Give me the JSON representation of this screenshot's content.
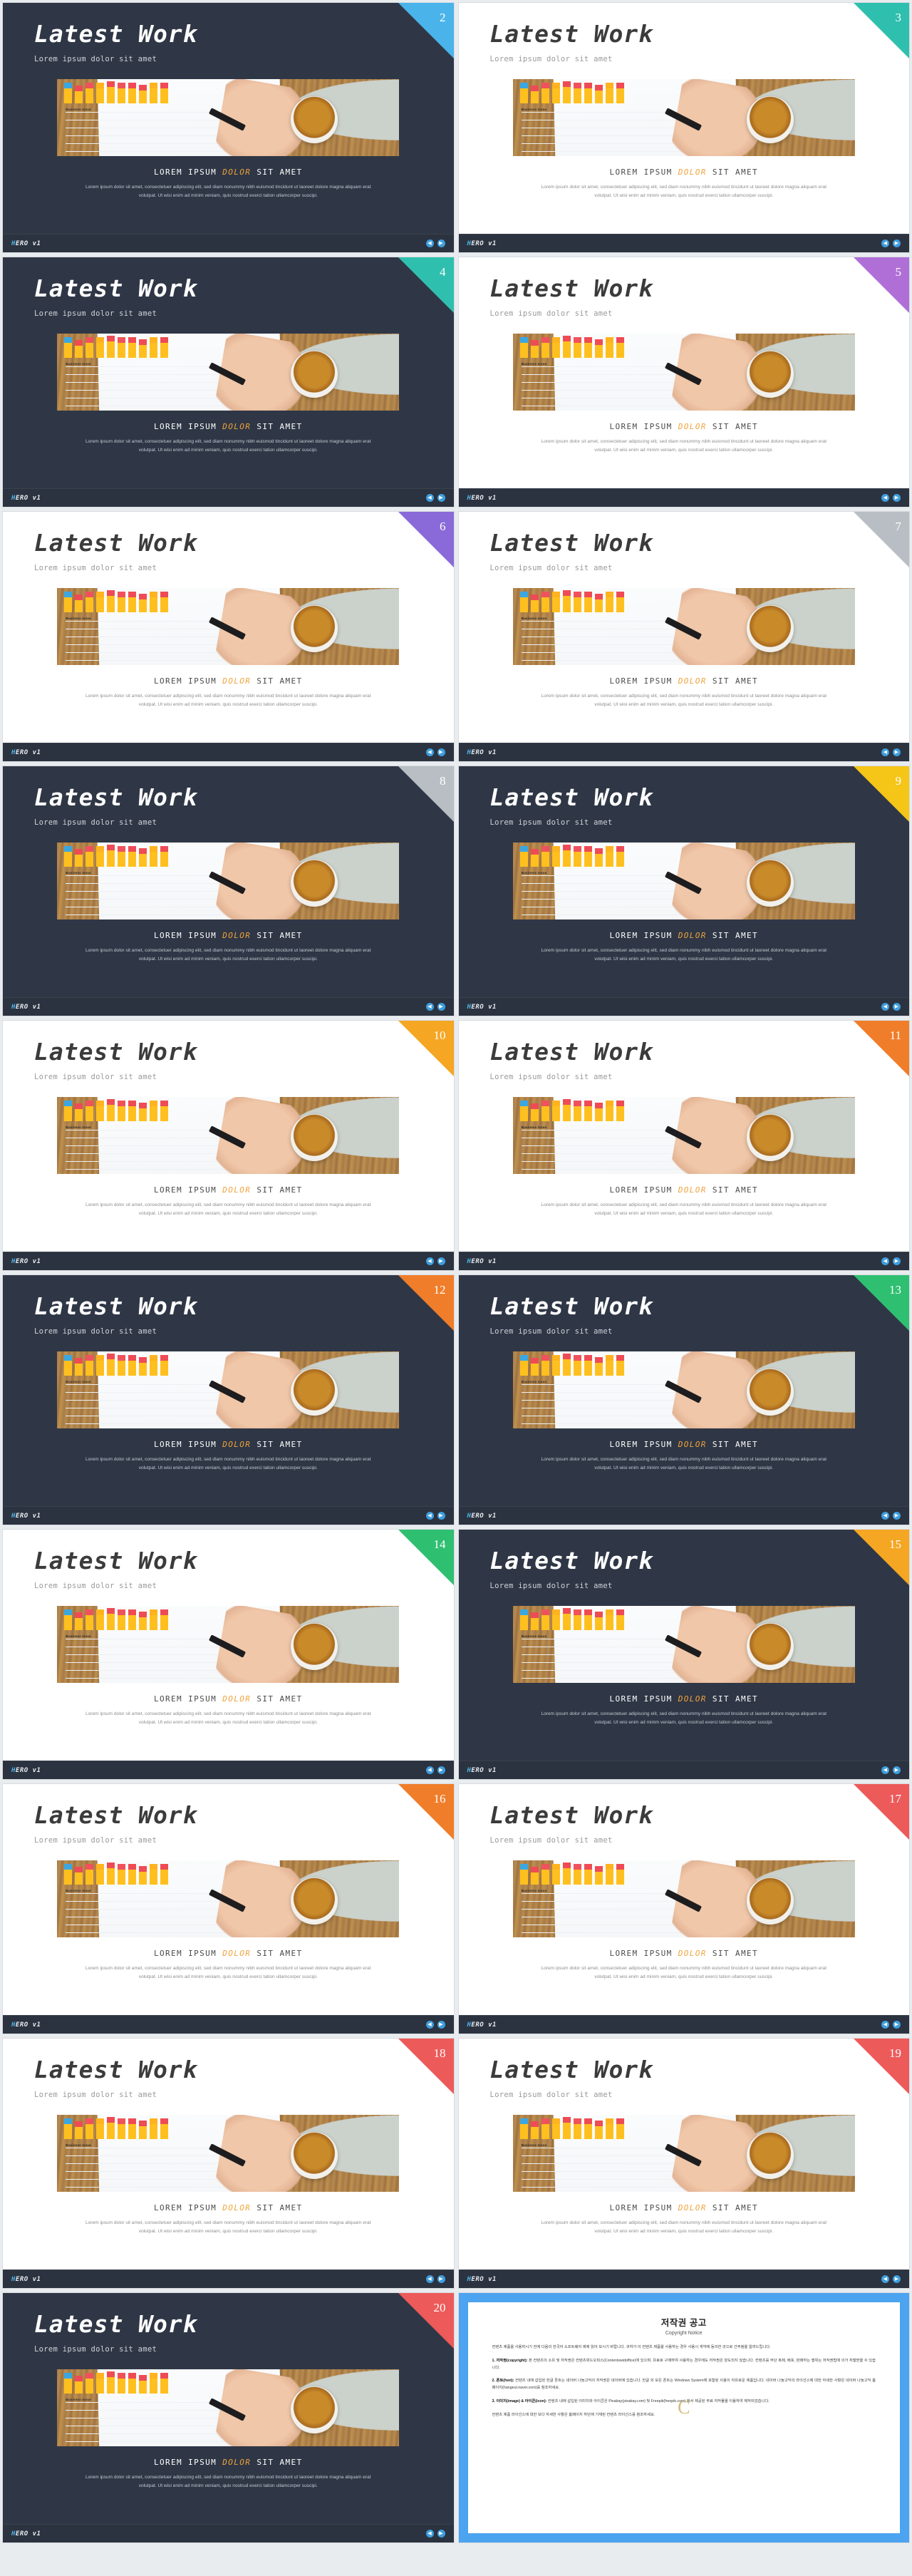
{
  "slide_common": {
    "title": "Latest Work",
    "subtitle": "Lorem ipsum dolor sit amet",
    "caption_pre": "LOREM IPSUM ",
    "caption_accent": "DOLOR",
    "caption_post": " SIT AMET",
    "body": "Lorem ipsum dolor sit amet, consectetuer adipiscing elit, sed diam nonummy nibh euismod tincidunt ut laoreet dolore magna aliquam erat volutpat. Ut wisi enim ad minim veniam, quis nostrud exerci tation ullamcorper suscipi.",
    "brand_first": "H",
    "brand_rest": "ERO v1",
    "nav_prev": "◀",
    "nav_next": "▶",
    "photo_label": "Business Issue"
  },
  "slides": [
    {
      "n": "2",
      "theme": "dark",
      "ribbon": "#4ab4ea"
    },
    {
      "n": "3",
      "theme": "light",
      "ribbon": "#2fbfae"
    },
    {
      "n": "4",
      "theme": "dark",
      "ribbon": "#2fbfae"
    },
    {
      "n": "5",
      "theme": "light",
      "ribbon": "#b06fd6"
    },
    {
      "n": "6",
      "theme": "light",
      "ribbon": "#8a6ad8"
    },
    {
      "n": "7",
      "theme": "light",
      "ribbon": "#b9bec4"
    },
    {
      "n": "8",
      "theme": "dark",
      "ribbon": "#b9bec4"
    },
    {
      "n": "9",
      "theme": "dark",
      "ribbon": "#f5c518"
    },
    {
      "n": "10",
      "theme": "light",
      "ribbon": "#f5a623"
    },
    {
      "n": "11",
      "theme": "light",
      "ribbon": "#f07d2a"
    },
    {
      "n": "12",
      "theme": "dark",
      "ribbon": "#f07d2a"
    },
    {
      "n": "13",
      "theme": "dark",
      "ribbon": "#2fbf71"
    },
    {
      "n": "14",
      "theme": "light",
      "ribbon": "#2fbf71"
    },
    {
      "n": "15",
      "theme": "dark",
      "ribbon": "#f5a623"
    },
    {
      "n": "16",
      "theme": "light",
      "ribbon": "#f07d2a"
    },
    {
      "n": "17",
      "theme": "light",
      "ribbon": "#ed5a5a"
    },
    {
      "n": "18",
      "theme": "light",
      "ribbon": "#ed5a5a"
    },
    {
      "n": "19",
      "theme": "light",
      "ribbon": "#ed5a5a"
    },
    {
      "n": "20",
      "theme": "dark",
      "ribbon": "#ed5a5a"
    }
  ],
  "copyright": {
    "title": "저작권 공고",
    "subtitle": "Copyright Notice",
    "watermark": "C",
    "intro": "컨텐츠 제품을 사용하시기 전에 다음의 한국어 소프트웨어 제에 읽어 보시기 바랍니다. 귀하가 이 컨텐츠 제품을 사용하는 경우 사용시 게약에 동의한 것으로 간주됨을 알려드립니다.",
    "items": [
      {
        "lead": "1. 저작권(copyright):",
        "text": " 본 컨텐츠의 소유 및 저작권은 컨텐츠위드오피스(Contentswidoffice)에 있으며, 유료로 구매하여 사용하는 경우에도 저작권은 양도되지 않습니다. 컨텐츠를 무단 복제, 배포, 판매하는 행위는 저작권법에 의거 처벌받을 수 있습니다."
      },
      {
        "lead": "2. 폰트(font):",
        "text": " 컨텐츠 내에 삽입된 한글 폰트는 네이버 나눔고딕의 저작권은 네이버에 있습니다. 한글 외 모든 폰트는 Windows System에 포함된 사용이 자유로운 제품입니다. 네이버 나눔고딕의 라이선스에 대한 자세한 사항은 네이버 나눔고딕 홈페이지(hangeul.naver.com)를 참조하세요."
      },
      {
        "lead": "3. 이미지(image) & 아이콘(icon):",
        "text": " 컨텐츠 내에 삽입된 이미지와 아이콘은 Pixabay(pixabay.com) 및 Freepik(freepik.com) 에서 제공된 무료 저작물을 이용하여 제작되었습니다."
      },
      {
        "lead": "",
        "text": "컨텐츠 제품 라이선스에 대한 보다 자세한 사항은 홈페이지 하단에 기재된 컨텐츠 라이선스를 참조하세요."
      }
    ]
  }
}
